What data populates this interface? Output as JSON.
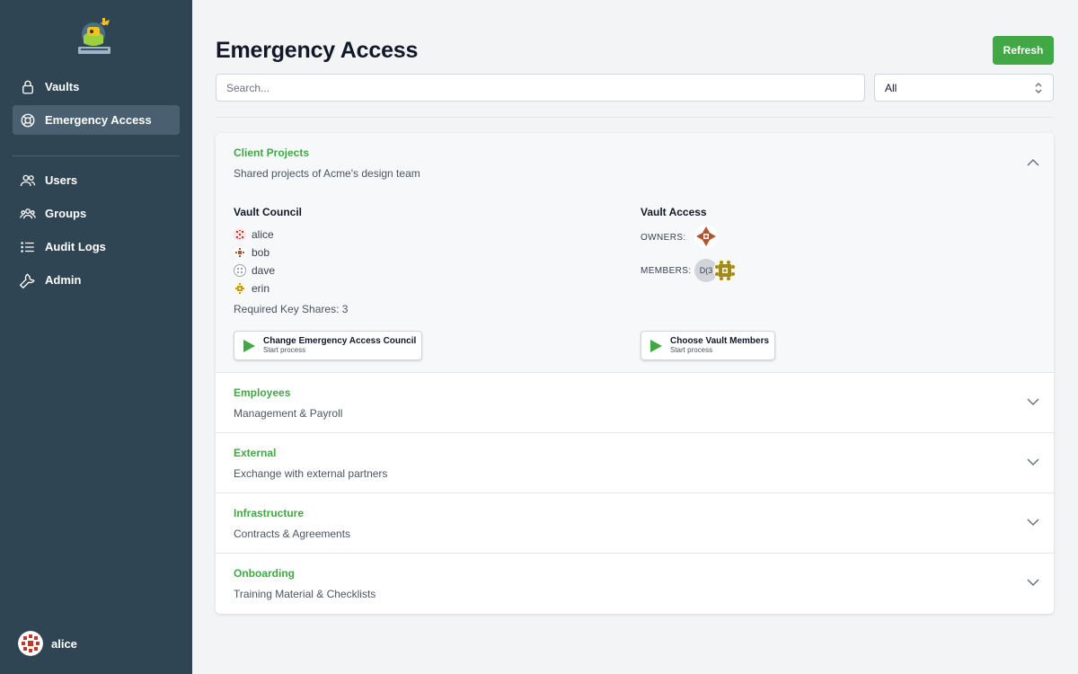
{
  "sidebar": {
    "nav_top": [
      {
        "label": "Vaults",
        "icon": "lock-icon",
        "active": false
      },
      {
        "label": "Emergency Access",
        "icon": "lifebuoy-icon",
        "active": true
      }
    ],
    "nav_bottom": [
      {
        "label": "Users",
        "icon": "users-icon"
      },
      {
        "label": "Groups",
        "icon": "groups-icon"
      },
      {
        "label": "Audit Logs",
        "icon": "list-icon"
      },
      {
        "label": "Admin",
        "icon": "wrench-icon"
      }
    ],
    "current_user": "alice"
  },
  "header": {
    "title": "Emergency Access",
    "refresh_label": "Refresh"
  },
  "filters": {
    "search_placeholder": "Search...",
    "select_value": "All"
  },
  "vaults": [
    {
      "name": "Client Projects",
      "description": "Shared projects of Acme's design team",
      "expanded": true,
      "council_title": "Vault Council",
      "council_members": [
        "alice",
        "bob",
        "dave",
        "erin"
      ],
      "required_key_shares": "Required Key Shares: 3",
      "access_title": "Vault Access",
      "owners_label": "OWNERS:",
      "members_label": "MEMBERS:",
      "members_badge": "D(3",
      "change_council_label": "Change Emergency Access Council",
      "change_council_sub": "Start process",
      "choose_members_label": "Choose Vault Members",
      "choose_members_sub": "Start process"
    },
    {
      "name": "Employees",
      "description": "Management & Payroll",
      "expanded": false
    },
    {
      "name": "External",
      "description": "Exchange with external partners",
      "expanded": false
    },
    {
      "name": "Infrastructure",
      "description": "Contracts & Agreements",
      "expanded": false
    },
    {
      "name": "Onboarding",
      "description": "Training Material & Checklists",
      "expanded": false
    }
  ],
  "colors": {
    "sidebar_bg": "#2f4553",
    "accent_green": "#41a845",
    "active_nav_bg": "#4a6070"
  }
}
